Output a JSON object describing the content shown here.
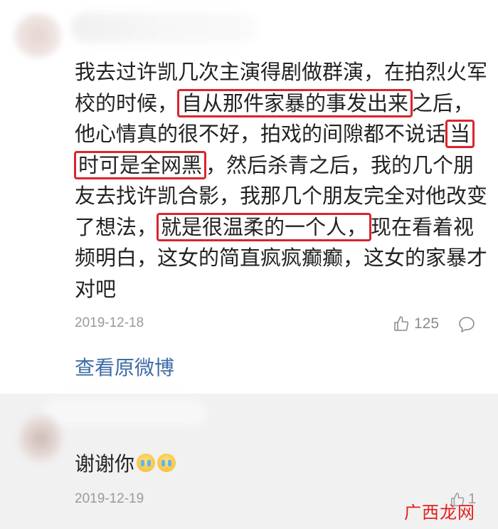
{
  "comment1": {
    "text_segments": [
      {
        "text": "我去过许凯几次主演得剧做群演，在拍烈火军校的时候，",
        "highlight": false
      },
      {
        "text": "自从那件家暴的事发出来",
        "highlight": true
      },
      {
        "text": "之后，他心情真的很不好，拍戏的间隙都不说话",
        "highlight": false
      },
      {
        "text": "当时可是全网黑",
        "highlight": true
      },
      {
        "text": "，然后杀青之后，我的几个朋友去找许凯合影，我那几个朋友完全对他改变了想法，",
        "highlight": false
      },
      {
        "text": "就是很温柔的一个人，",
        "highlight": true
      },
      {
        "text": "现在看着视频明白，这女的简直疯疯癫癫，这女的家暴才对吧",
        "highlight": false
      }
    ],
    "date": "2019-12-18",
    "like_count": "125",
    "view_original": "查看原微博"
  },
  "comment2": {
    "text": "谢谢你",
    "emojis": [
      "crying-emoji",
      "crying-emoji"
    ],
    "date": "2019-12-19",
    "like_count": "1"
  },
  "watermark": {
    "part1": "广西",
    "part2": "龙网"
  },
  "colors": {
    "highlight_border": "#d8262d",
    "link": "#3e6da6",
    "muted": "#9a9a9a"
  }
}
